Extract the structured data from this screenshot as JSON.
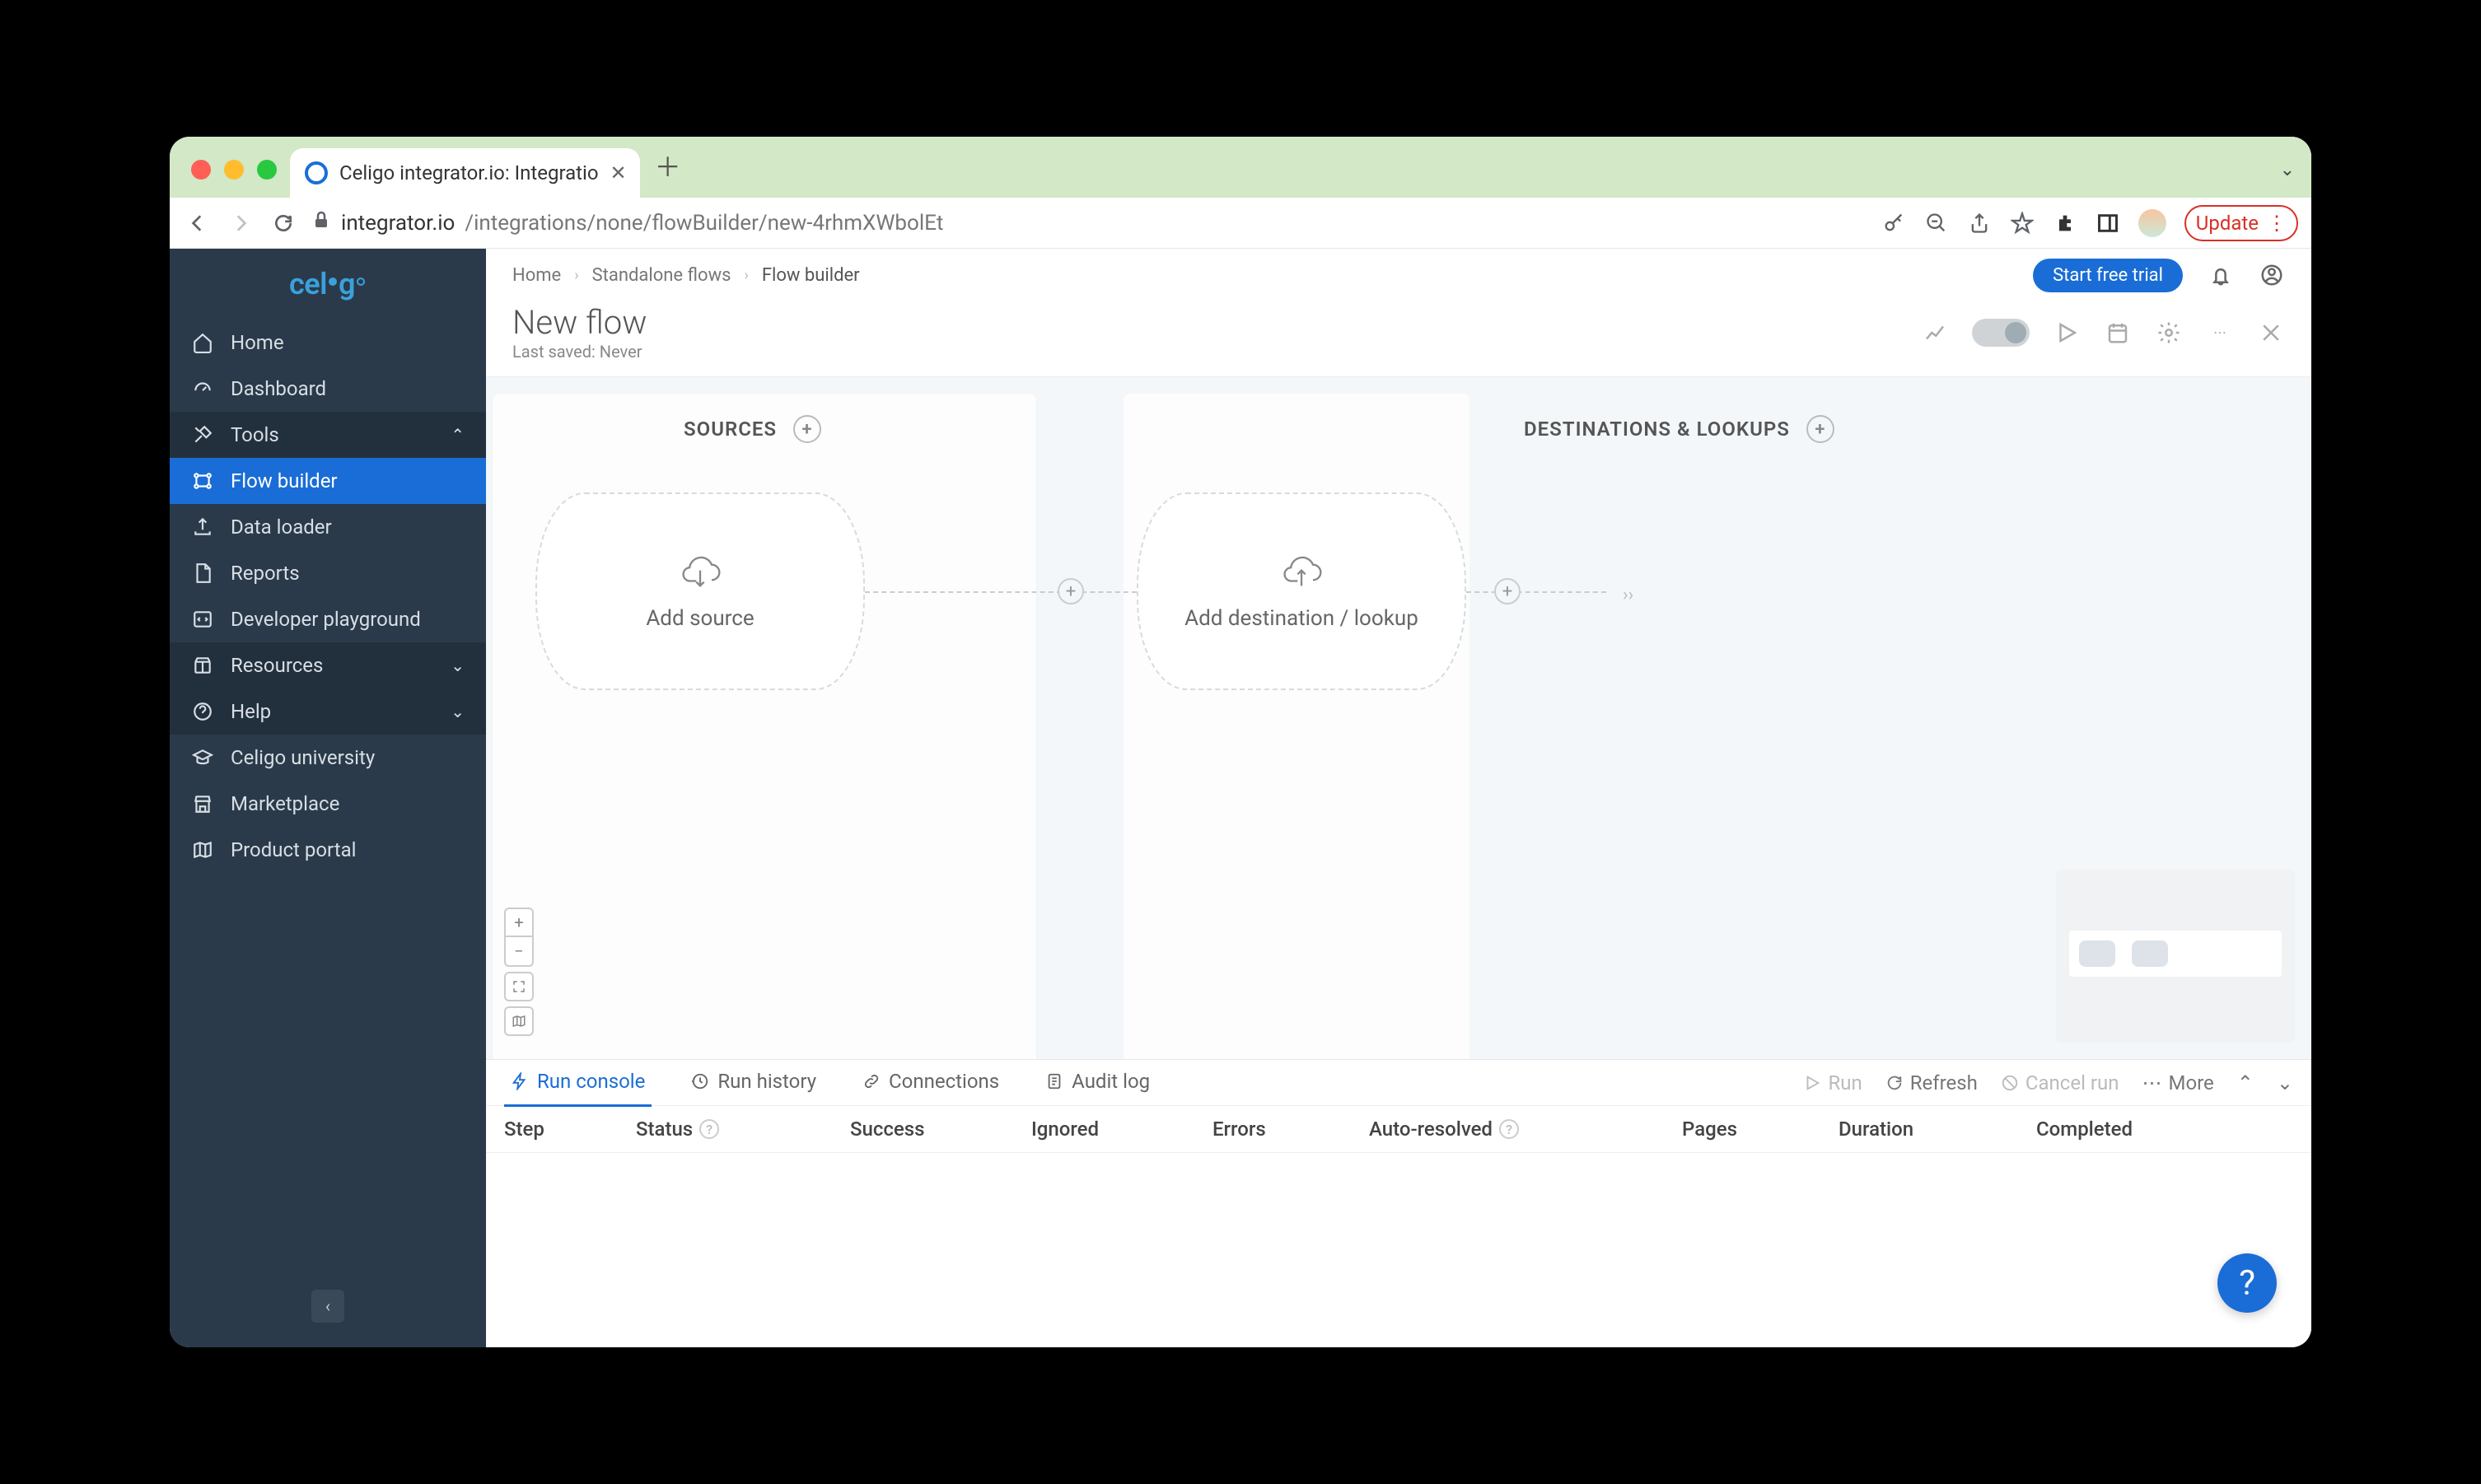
{
  "browser": {
    "tab_title": "Celigo integrator.io: Integratio",
    "url_host": "integrator.io",
    "url_path": "/integrations/none/flowBuilder/new-4rhmXWbolEt",
    "update_label": "Update"
  },
  "sidebar": {
    "logo": "celigo",
    "items": [
      {
        "label": "Home",
        "icon": "home"
      },
      {
        "label": "Dashboard",
        "icon": "gauge"
      },
      {
        "label": "Tools",
        "icon": "tools",
        "expandable": true,
        "expanded": true
      },
      {
        "label": "Flow builder",
        "icon": "flow",
        "active": true,
        "indent": true
      },
      {
        "label": "Data loader",
        "icon": "upload",
        "indent": true
      },
      {
        "label": "Reports",
        "icon": "file",
        "indent": true
      },
      {
        "label": "Developer playground",
        "icon": "code",
        "indent": true
      },
      {
        "label": "Resources",
        "icon": "box",
        "expandable": true,
        "expanded": false
      },
      {
        "label": "Help",
        "icon": "help",
        "expandable": true,
        "expanded": false
      },
      {
        "label": "Celigo university",
        "icon": "grad"
      },
      {
        "label": "Marketplace",
        "icon": "store"
      },
      {
        "label": "Product portal",
        "icon": "map"
      }
    ]
  },
  "header": {
    "breadcrumbs": [
      "Home",
      "Standalone flows",
      "Flow builder"
    ],
    "cta": "Start free trial",
    "flow_name": "New flow",
    "last_saved_prefix": "Last saved:",
    "last_saved_value": "Never"
  },
  "canvas": {
    "sources_label": "SOURCES",
    "destinations_label": "DESTINATIONS & LOOKUPS",
    "add_source": "Add source",
    "add_destination": "Add destination / lookup"
  },
  "console": {
    "tabs": [
      {
        "label": "Run console",
        "icon": "bolt",
        "active": true
      },
      {
        "label": "Run history",
        "icon": "clock"
      },
      {
        "label": "Connections",
        "icon": "link"
      },
      {
        "label": "Audit log",
        "icon": "doc"
      }
    ],
    "actions": {
      "run": "Run",
      "refresh": "Refresh",
      "cancel": "Cancel run",
      "more": "More"
    },
    "columns": [
      "Step",
      "Status",
      "Success",
      "Ignored",
      "Errors",
      "Auto-resolved",
      "Pages",
      "Duration",
      "Completed"
    ]
  }
}
